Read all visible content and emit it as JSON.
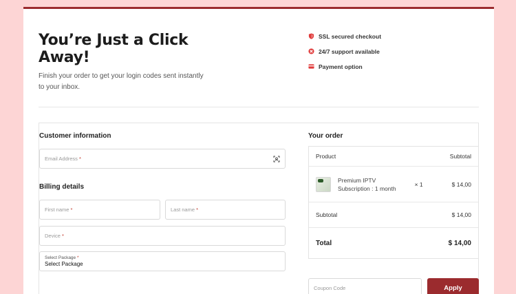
{
  "hero": {
    "title": "You’re Just a Click Away!",
    "subtitle": "Finish your order to get your login codes sent instantly to your inbox."
  },
  "features": [
    {
      "icon": "shield-icon",
      "label": "SSL secured checkout"
    },
    {
      "icon": "support-icon",
      "label": "24/7 support available"
    },
    {
      "icon": "card-icon",
      "label": "Payment option"
    }
  ],
  "customer": {
    "title": "Customer information",
    "email_placeholder": "Email Address"
  },
  "billing": {
    "title": "Billing details",
    "first_name_placeholder": "First name",
    "last_name_placeholder": "Last name",
    "device_placeholder": "Device",
    "package_label": "Select Package",
    "package_value": "Select Package"
  },
  "required_mark": "*",
  "order": {
    "title": "Your order",
    "col_product": "Product",
    "col_subtotal": "Subtotal",
    "item_name": "Premium IPTV",
    "item_variant": "Subscription : 1 month",
    "item_qty": "× 1",
    "item_price": "$ 14,00",
    "subtotal_label": "Subtotal",
    "subtotal_value": "$ 14,00",
    "total_label": "Total",
    "total_value": "$ 14,00"
  },
  "coupon": {
    "placeholder": "Coupon Code",
    "apply_label": "Apply"
  },
  "colors": {
    "accent": "#9b2b2e",
    "background": "#fdd5d5",
    "icon_red": "#e03a3a"
  }
}
